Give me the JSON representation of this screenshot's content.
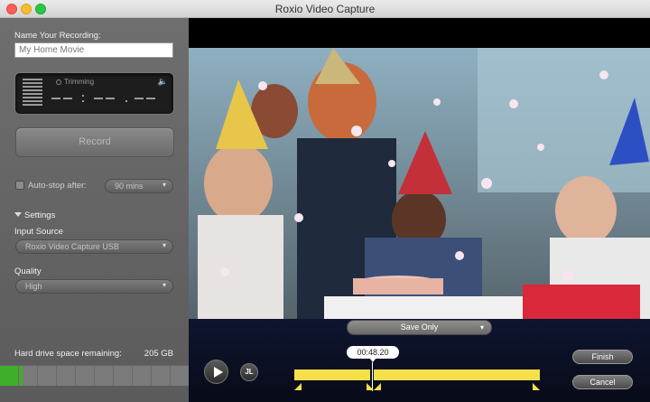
{
  "window": {
    "title": "Roxio Video Capture"
  },
  "sidebar": {
    "name_label": "Name Your Recording:",
    "name_placeholder": "My Home Movie",
    "meter": {
      "mode_label": "Trimming"
    },
    "record_label": "Record",
    "autostop": {
      "label": "Auto-stop after:",
      "checked": false,
      "value": "90 mins"
    },
    "settings_label": "Settings",
    "input_source": {
      "label": "Input Source",
      "value": "Roxio Video Capture USB"
    },
    "quality": {
      "label": "Quality",
      "value": "High"
    },
    "disk": {
      "label": "Hard drive space remaining:",
      "value": "205 GB",
      "used_fraction": 0.12
    }
  },
  "player": {
    "save_mode": "Save Only",
    "current_time": "00:48.20",
    "trim_label": "JL",
    "finish_label": "Finish",
    "cancel_label": "Cancel"
  },
  "colors": {
    "timeline": "#f5e04a",
    "disk_fill": "#3fae2b"
  }
}
